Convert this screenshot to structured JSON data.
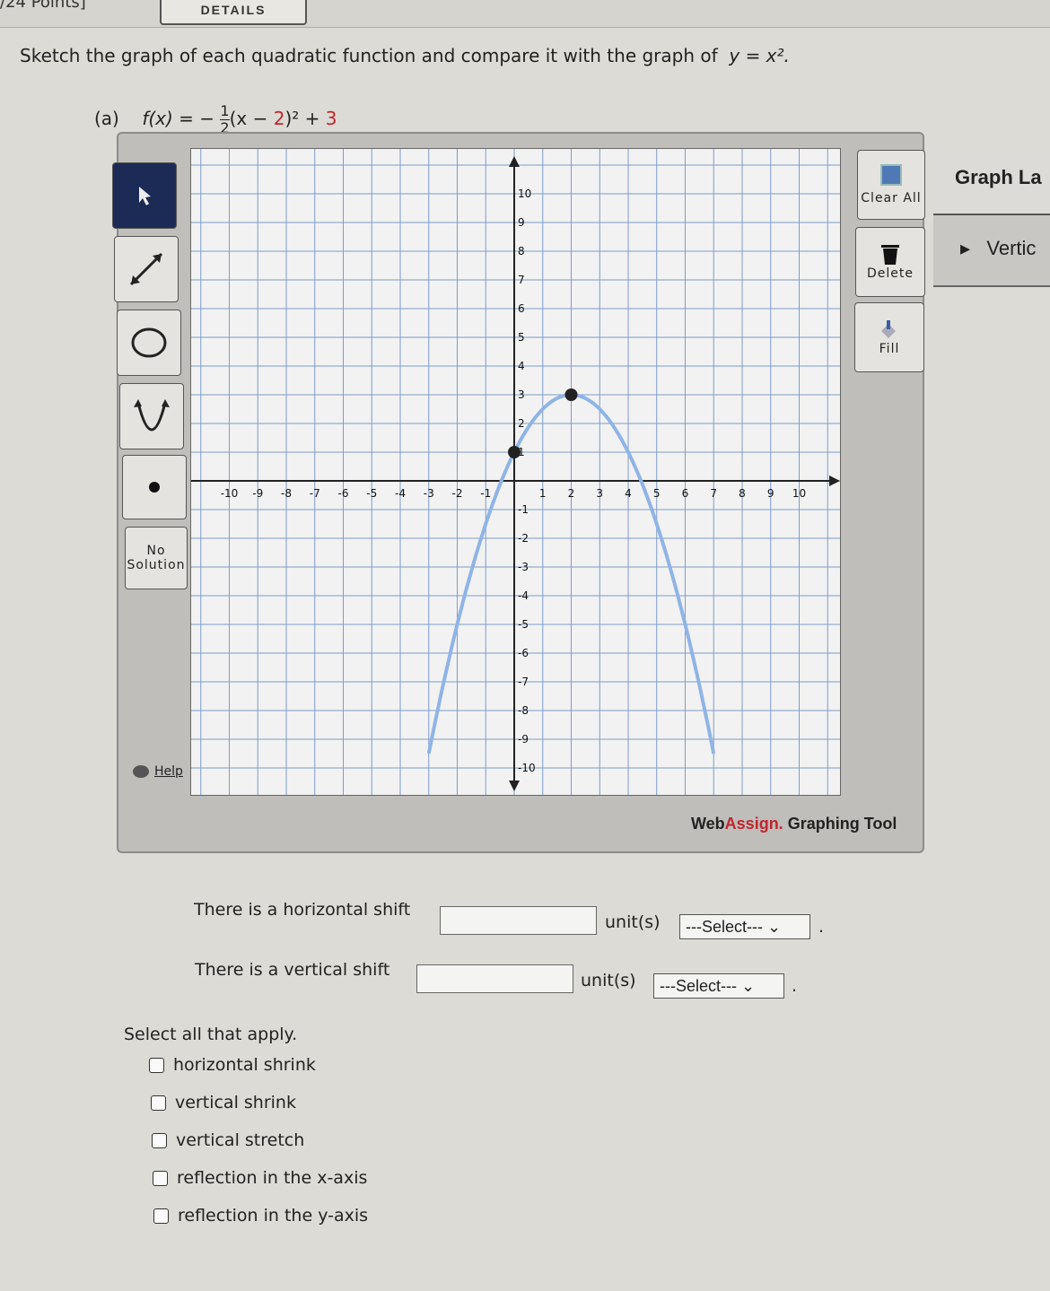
{
  "header": {
    "points": "/24 Points]",
    "details": "DETAILS"
  },
  "prompt": {
    "text": "Sketch the graph of each quadratic function and compare it with the graph of",
    "eq": "y = x²."
  },
  "part_a": {
    "label": "(a)",
    "f_prefix": "f(x) = −",
    "frac_num": "1",
    "frac_den": "2",
    "f_mid": "(x − ",
    "h": "2",
    "f_after": ")² + ",
    "k": "3"
  },
  "toolbar": {
    "tools": [
      {
        "name": "pointer",
        "icon": "pointer-icon"
      },
      {
        "name": "line",
        "icon": "line-icon"
      },
      {
        "name": "circle",
        "icon": "circle-icon"
      },
      {
        "name": "parabola",
        "icon": "parabola-icon"
      },
      {
        "name": "point",
        "icon": "point-icon"
      }
    ],
    "no_solution": [
      "No",
      "Solution"
    ],
    "help": "Help"
  },
  "actions": {
    "clear_all": "Clear All",
    "delete": "Delete",
    "fill": "Fill"
  },
  "side_panel": {
    "title": "Graph La",
    "item": "Vertic"
  },
  "brand": {
    "web": "Web",
    "assign": "Assign.",
    "rest": " Graphing Tool"
  },
  "graph": {
    "xlim": [
      -11,
      11.5
    ],
    "ylim": [
      -11,
      11
    ],
    "x_ticks": [
      -10,
      -9,
      -8,
      -7,
      -6,
      -5,
      -4,
      -3,
      -2,
      -1,
      1,
      2,
      3,
      4,
      5,
      6,
      7,
      8,
      9,
      10
    ],
    "y_ticks": [
      10,
      9,
      8,
      7,
      6,
      5,
      4,
      3,
      2,
      1,
      -1,
      -2,
      -3,
      -4,
      -5,
      -6,
      -7,
      -8,
      -9,
      -10
    ],
    "curve": {
      "type": "parabola",
      "a": -0.5,
      "h": 2,
      "k": 3,
      "color": "#8fb4e6"
    },
    "points": [
      [
        2,
        3
      ],
      [
        0,
        1
      ]
    ]
  },
  "questions": {
    "h_shift": "There is a horizontal shift",
    "v_shift": "There is a vertical shift",
    "units": "unit(s)",
    "select": "---Select---",
    "period": ".",
    "select_all": "Select all that apply."
  },
  "options": [
    "horizontal shrink",
    "vertical shrink",
    "vertical stretch",
    "reflection in the x-axis",
    "reflection in the y-axis"
  ]
}
